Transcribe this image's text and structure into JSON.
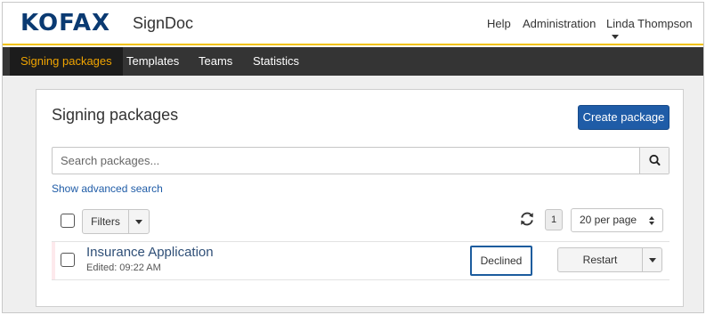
{
  "brand": {
    "logo": "KOFAX",
    "product": "SignDoc"
  },
  "header": {
    "help": "Help",
    "administration": "Administration",
    "user_name": "Linda Thompson"
  },
  "nav": {
    "items": [
      {
        "label": "Signing packages",
        "active": true
      },
      {
        "label": "Templates",
        "active": false
      },
      {
        "label": "Teams",
        "active": false
      },
      {
        "label": "Statistics",
        "active": false
      }
    ]
  },
  "main": {
    "title": "Signing packages",
    "create_button": "Create package",
    "search": {
      "placeholder": "Search packages...",
      "value": ""
    },
    "advanced_search": "Show advanced search",
    "filters_label": "Filters",
    "pagination": {
      "current_page": "1",
      "per_page": "20 per page"
    },
    "packages": [
      {
        "title": "Insurance Application",
        "edited": "Edited: 09:22 AM",
        "status": "Declined",
        "action": "Restart"
      }
    ]
  },
  "colors": {
    "brand_blue": "#0a3a72",
    "primary_button": "#1f5ca7",
    "nav_bg": "#343434",
    "nav_active_text": "#f0a400",
    "header_accent": "#f2c200",
    "status_border": "#1c5c9e"
  },
  "icons": {
    "search": "search-icon",
    "refresh": "refresh-icon",
    "dropdown": "chevron-down-icon",
    "sort": "up-down-arrows-icon"
  }
}
